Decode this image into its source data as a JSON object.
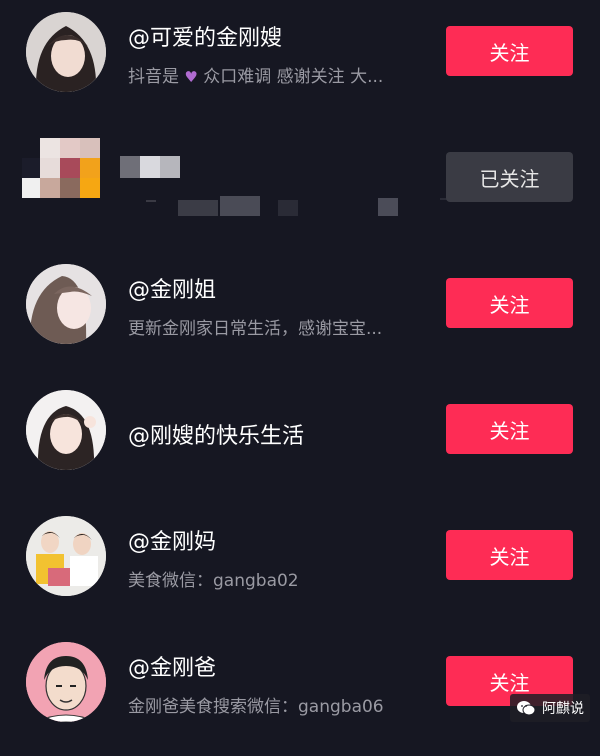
{
  "users": [
    {
      "name": "@可爱的金刚嫂",
      "desc_prefix": "抖音是",
      "desc_suffix": "众口难调 感谢关注 大...",
      "button": "关注",
      "followed": false
    },
    {
      "name": "",
      "desc": "",
      "button": "已关注",
      "followed": true
    },
    {
      "name": "@金刚姐",
      "desc": "更新金刚家日常生活，感谢宝宝...",
      "button": "关注",
      "followed": false
    },
    {
      "name": "@刚嫂的快乐生活",
      "desc": "",
      "button": "关注",
      "followed": false
    },
    {
      "name": "@金刚妈",
      "desc": "美食微信：gangba02",
      "button": "关注",
      "followed": false
    },
    {
      "name": "@金刚爸",
      "desc": "金刚爸美食搜索微信：gangba06",
      "button": "关注",
      "followed": false
    }
  ],
  "watermark": {
    "text": "阿麒说"
  },
  "colors": {
    "follow": "#fe2c55",
    "followed": "#3a3b44",
    "background": "#161722"
  },
  "icons": {
    "heart": "heart-icon",
    "wechat": "wechat-icon"
  }
}
